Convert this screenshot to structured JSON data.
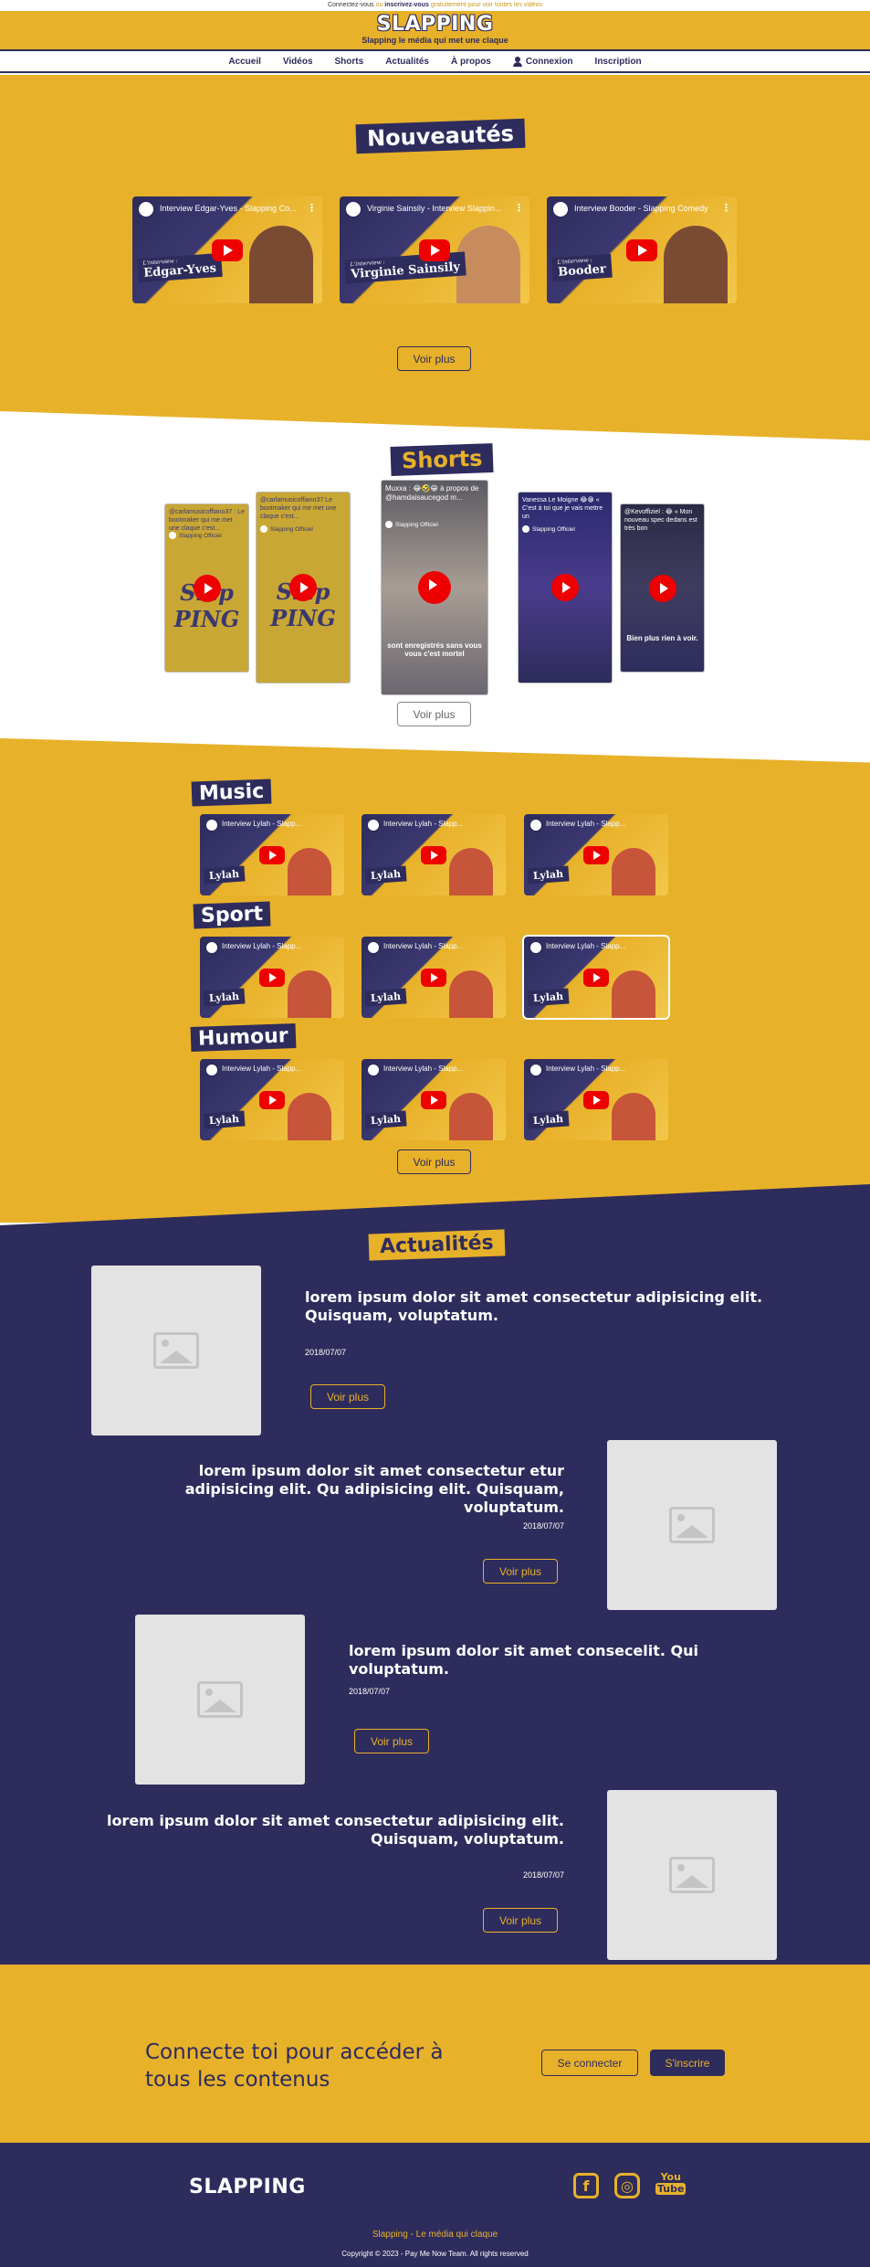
{
  "topbar": {
    "pre": "Connectez-vous",
    "or": "ou",
    "reg": "inscrivez-vous",
    "post": "gratuitement pour voir toutes les vidéos"
  },
  "brand": {
    "name": "SLAPPING",
    "tagline": "Slapping le média qui met une claque"
  },
  "nav": {
    "items": [
      "Accueil",
      "Vidéos",
      "Shorts",
      "Actualités",
      "À propos"
    ],
    "login": "Connexion",
    "signup": "Inscription"
  },
  "nouveautes": {
    "title": "Nouveautés",
    "videos": [
      {
        "title": "Interview Edgar-Yves - Slapping Co...",
        "label": "Edgar-Yves",
        "kicker": "L'interview :"
      },
      {
        "title": "Virginie Sainsily - Interview Slappin...",
        "label": "Virginie Sainsily",
        "kicker": "L'interview :"
      },
      {
        "title": "Interview Booder - Slapping Comedy",
        "label": "Booder",
        "kicker": "L'interview :"
      }
    ],
    "more": "Voir plus"
  },
  "shorts": {
    "title": "Shorts",
    "items": [
      {
        "text": "@carlamusicoffiano37 : Le bootmaker qui me met une claque c'est...",
        "owner": "Slapping Officiel",
        "logo": "Slap PING"
      },
      {
        "text": "@carlamusicoffiano37 Le bootmaker qui me met une claque c'est...",
        "owner": "Slapping Officiel",
        "logo": "Slap PING"
      },
      {
        "text": "Muxxa : 😂🤣😁 à propos de @hamdaisaucegod m...",
        "owner": "Slapping Officiel",
        "caption": "sont enregistrés sans vous vous c'est mortel"
      },
      {
        "text": "Vanessa Le Moigne 😂😁 « C'est à toi que je vais mettre un",
        "owner": "Slapping Officiel",
        "caption": ""
      },
      {
        "text": "@Kevoffiziel : 😂 « Mon nouveau spec dedans est très bon",
        "owner": "",
        "caption": "Bien plus rien à voir."
      }
    ],
    "more": "Voir plus"
  },
  "categories": [
    {
      "title": "Music",
      "videos": [
        "Interview Lylah - Slapp...",
        "Interview Lylah - Slapp...",
        "Interview Lylah - Slapp..."
      ]
    },
    {
      "title": "Sport",
      "videos": [
        "Interview Lylah - Slapp...",
        "Interview Lylah - Slapp...",
        "Interview Lylah - Slapp..."
      ]
    },
    {
      "title": "Humour",
      "videos": [
        "Interview Lylah - Slapp...",
        "Interview Lylah - Slapp...",
        "Interview Lylah - Slapp..."
      ]
    }
  ],
  "categories_label": "Lylah",
  "categories_more": "Voir plus",
  "actualites": {
    "title": "Actualités",
    "articles": [
      {
        "title": "lorem ipsum dolor sit amet consectetur adipisicing elit. Quisquam, voluptatum.",
        "date": "2018/07/07",
        "btn": "Voir plus"
      },
      {
        "title": "lorem ipsum dolor sit amet consectetur etur adipisicing elit. Qu adipisicing elit. Quisquam, voluptatum.",
        "date": "2018/07/07",
        "btn": "Voir plus"
      },
      {
        "title": "lorem ipsum dolor sit amet consecelit. Qui voluptatum.",
        "date": "2018/07/07",
        "btn": "Voir plus"
      },
      {
        "title": "lorem ipsum dolor sit amet consectetur adipisicing elit. Quisquam, voluptatum.",
        "date": "2018/07/07",
        "btn": "Voir plus"
      }
    ]
  },
  "cta": {
    "text_line1": "Connecte toi pour accéder à",
    "text_line2": "tous les contenus",
    "login": "Se connecter",
    "signup": "S'inscrire"
  },
  "footer": {
    "logo": "SLAPPING",
    "tagline": "Slapping - Le média qui claque",
    "copyright": "Copyright © 2023 - Pay Me Now Team. All rights reserved",
    "youtube_top": "You",
    "youtube_bottom": "Tube"
  },
  "colors": {
    "gold": "#e8b12a",
    "navy": "#2e2c5c"
  }
}
